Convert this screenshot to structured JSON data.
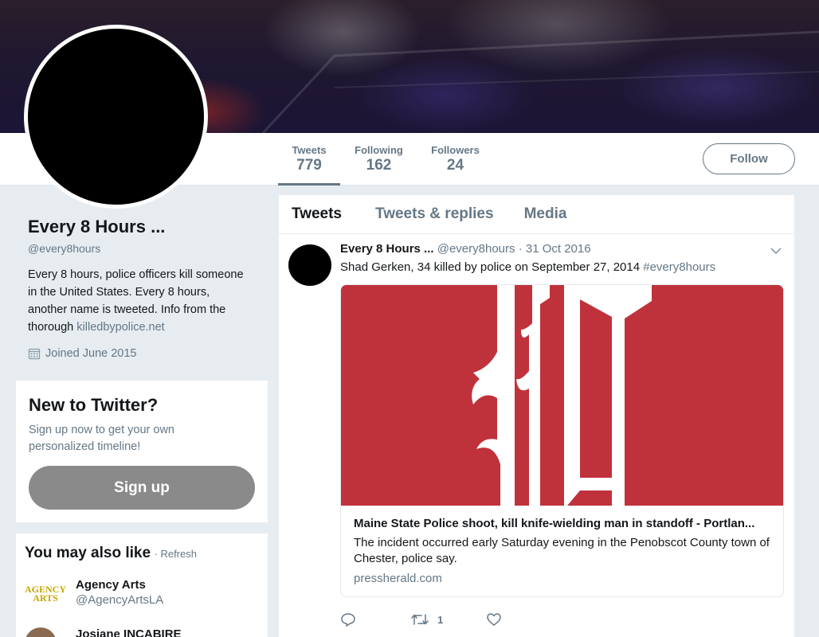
{
  "profile_nav": {
    "stats": [
      {
        "label": "Tweets",
        "value": "779"
      },
      {
        "label": "Following",
        "value": "162"
      },
      {
        "label": "Followers",
        "value": "24"
      }
    ],
    "follow_label": "Follow"
  },
  "profile": {
    "name": "Every 8 Hours ...",
    "handle": "@every8hours",
    "bio": "Every 8 hours, police officers kill someone in the United States. Every 8 hours, another name is tweeted. Info from the thorough",
    "bio_link": "killedbypolice.net",
    "joined": "Joined June 2015",
    "joined_icon": "calendar-icon"
  },
  "new_to_twitter": {
    "title": "New to Twitter?",
    "text": "Sign up now to get your own personalized timeline!",
    "signup_label": "Sign up"
  },
  "who_to_follow": {
    "title": "You may also like",
    "refresh": "· Refresh",
    "suggestions": [
      {
        "name": "Agency Arts",
        "handle": "@AgencyArtsLA",
        "thumb_text": "AGENCY ARTS"
      },
      {
        "name": "Josiane INCABIRE",
        "handle": ""
      }
    ]
  },
  "timeline": {
    "tabs": [
      "Tweets",
      "Tweets & replies",
      "Media"
    ],
    "active_tab": "Tweets"
  },
  "tweet": {
    "name": "Every 8 Hours ...",
    "handle": "@every8hours",
    "date": "· 31 Oct 2016",
    "text": "Shad Gerken, 34 killed by police on September 27, 2014",
    "hashtag": "#every8hours",
    "card": {
      "title": "Maine State Police shoot, kill knife-wielding man in standoff - Portlan...",
      "description": "The incident occurred early Saturday evening in the Penobscot County town of Chester, police say.",
      "domain": "pressherald.com",
      "image_color": "#c0323b"
    },
    "actions": {
      "reply_icon": "reply-icon",
      "retweet_icon": "retweet-icon",
      "retweet_count": "1",
      "like_icon": "heart-icon"
    }
  },
  "colors": {
    "background": "#e6ecf0",
    "muted_text": "#657786",
    "signup_button": "#8a8a8a"
  }
}
